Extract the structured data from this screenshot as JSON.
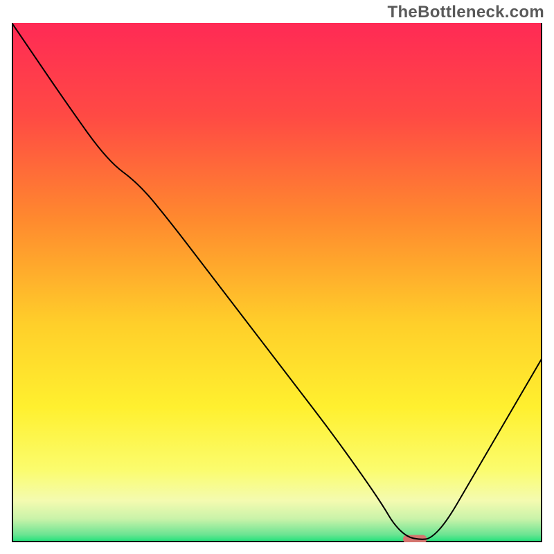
{
  "watermark": "TheBottleneck.com",
  "chart_data": {
    "type": "line",
    "title": "",
    "xlabel": "",
    "ylabel": "",
    "xlim": [
      0,
      100
    ],
    "ylim": [
      0,
      100
    ],
    "grid": false,
    "legend": false,
    "background_gradient_stops": [
      {
        "offset": 0.0,
        "color": "#ff2a55"
      },
      {
        "offset": 0.18,
        "color": "#ff4a44"
      },
      {
        "offset": 0.38,
        "color": "#ff8a2e"
      },
      {
        "offset": 0.58,
        "color": "#ffcf2a"
      },
      {
        "offset": 0.74,
        "color": "#fff02f"
      },
      {
        "offset": 0.86,
        "color": "#fbfc6d"
      },
      {
        "offset": 0.92,
        "color": "#f4fbb0"
      },
      {
        "offset": 0.955,
        "color": "#c9f3a9"
      },
      {
        "offset": 0.985,
        "color": "#6de493"
      },
      {
        "offset": 1.0,
        "color": "#18e277"
      }
    ],
    "series": [
      {
        "name": "bottleneck-curve",
        "color": "#000000",
        "width": 2,
        "x": [
          0.0,
          4.0,
          10.0,
          18.0,
          24.0,
          30.0,
          36.0,
          42.0,
          48.0,
          54.0,
          60.0,
          66.0,
          70.0,
          72.0,
          74.5,
          77.0,
          79.0,
          82.0,
          86.0,
          90.0,
          94.0,
          100.0
        ],
        "y": [
          100.0,
          94.0,
          85.0,
          73.5,
          69.0,
          61.5,
          53.5,
          45.5,
          37.5,
          29.5,
          21.5,
          13.0,
          7.0,
          3.5,
          1.0,
          0.5,
          0.7,
          4.0,
          11.0,
          18.0,
          25.0,
          35.5
        ]
      }
    ],
    "marker": {
      "name": "optimal-range-marker",
      "color": "#d4756f",
      "x_center": 76.0,
      "y": 0.6,
      "width": 4.5,
      "height": 1.6,
      "rx": 0.8
    },
    "axes": {
      "stroke": "#000000",
      "stroke_width": 4
    }
  }
}
